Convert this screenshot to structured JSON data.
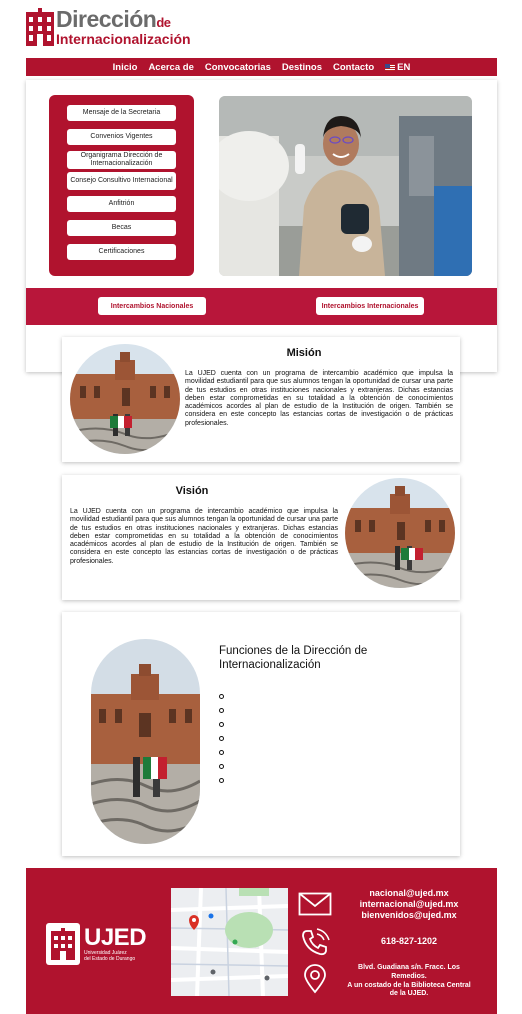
{
  "header": {
    "logo_line1": "Dirección",
    "logo_de": "de",
    "logo_line2": "Internacionalización"
  },
  "nav": {
    "items": [
      "Inicio",
      "Acerca de",
      "Convocatorias",
      "Destinos",
      "Contacto"
    ],
    "lang": "EN",
    "lang_icon": "us-flag-icon"
  },
  "menu": {
    "items": [
      "Mensaje de la Secretaria",
      "Convenios Vigentes",
      "Organigrama Dirección de Internacionalización",
      "Consejo Consultivo Internacional",
      "Anfitrión",
      "Becas",
      "Certificaciones"
    ]
  },
  "band": {
    "national": "Intercambios Nacionales",
    "international": "Intercambios Internacionales"
  },
  "mision": {
    "title": "Misión",
    "text": "La UJED cuenta con un programa de intercambio académico que impulsa la movilidad estudiantil para que sus alumnos tengan la oportunidad de cursar una parte de tus estudios en otras instituciones nacionales y extranjeras. Dichas estancias deben estar comprometidas en su totalidad a la obtención de conocimientos académicos acordes al plan de estudio de la Institución de origen. También se considera en este concepto las estancias cortas de investigación o de prácticas profesionales."
  },
  "vision": {
    "title": "Visión",
    "text": "La UJED cuenta con un programa de intercambio académico que impulsa la movilidad estudiantil para que sus alumnos tengan la oportunidad de cursar una parte de tus estudios en otras instituciones nacionales y extranjeras. Dichas estancias deben estar comprometidas en su totalidad a la obtención de conocimientos académicos acordes al plan de estudio de la Institución de origen. También se considera en este concepto las estancias cortas de investigación o de prácticas profesionales."
  },
  "funciones": {
    "title": "Funciones de la Dirección de Internacionalización",
    "bullet_count": 7
  },
  "footer": {
    "brand": "UJED",
    "brand_sub1": "Universidad Juárez",
    "brand_sub2": "del Estado de Durango",
    "emails": [
      "nacional@ujed.mx",
      "internacional@ujed.mx",
      "bienvenidos@ujed.mx"
    ],
    "phone": "618-827-1202",
    "address1": "Blvd. Guadiana s/n. Fracc. Los",
    "address2": "Remedios.",
    "address3": "A un costado de la Biblioteca Central",
    "address4": "de la UJED.",
    "icons": [
      "mail-icon",
      "phone-icon",
      "location-pin-icon"
    ]
  },
  "colors": {
    "brand_red": "#b0132e",
    "logo_gray": "#6b6b6b"
  }
}
